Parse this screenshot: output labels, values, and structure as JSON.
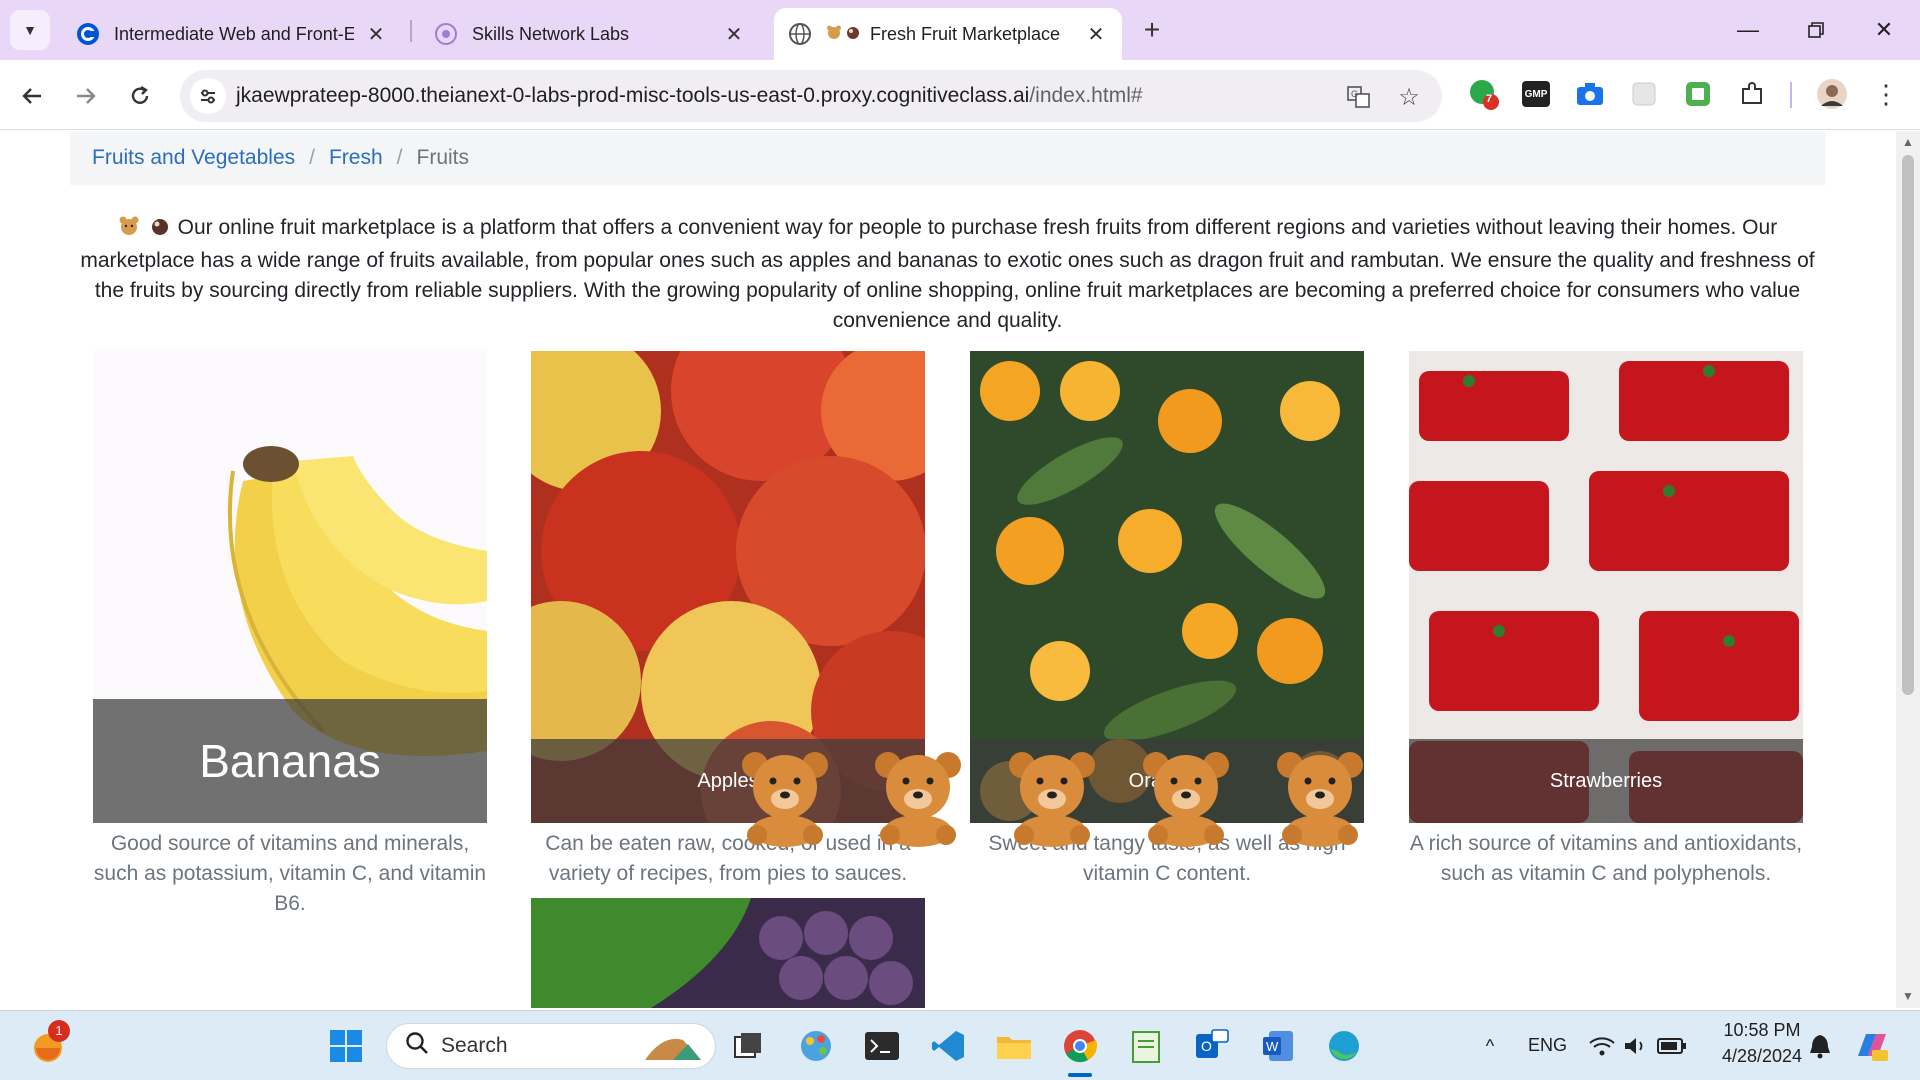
{
  "browser": {
    "tabs": [
      {
        "title": "Intermediate Web and Front-En",
        "close": "✕"
      },
      {
        "title": "Skills Network Labs",
        "close": "✕"
      },
      {
        "title": "Fresh Fruit Marketplace",
        "close": "✕",
        "active": true
      }
    ],
    "new_tab": "+",
    "url_host": "jkaewprateep-8000.theianext-0-labs-prod-misc-tools-us-east-0.proxy.cognitiveclass.ai",
    "url_path": "/index.html#",
    "extension_badge": "7",
    "gmp_label": "GMP"
  },
  "breadcrumb": {
    "items": [
      "Fruits and Vegetables",
      "Fresh"
    ],
    "current": "Fruits",
    "separator": "/"
  },
  "intro_text": "Our online fruit marketplace is a platform that offers a convenient way for people to purchase fresh fruits from different regions and varieties without leaving their homes. Our marketplace has a wide range of fruits available, from popular ones such as apples and bananas to exotic ones such as dragon fruit and rambutan. We ensure the quality and freshness of the fruits by sourcing directly from reliable suppliers. With the growing popularity of online shopping, online fruit marketplaces are becoming a preferred choice for consumers who value convenience and quality.",
  "fruits": [
    {
      "name": "Bananas",
      "desc": "Good source of vitamins and minerals, such as potassium, vitamin C, and vitamin B6."
    },
    {
      "name": "Apples",
      "desc": "Can be eaten raw, cooked, or used in a variety of recipes, from pies to sauces."
    },
    {
      "name": "Oranges",
      "desc": "Sweet and tangy taste, as well as high vitamin C content."
    },
    {
      "name": "Strawberries",
      "desc": "A rich source of vitamins and antioxidants, such as vitamin C and polyphenols."
    }
  ],
  "taskbar": {
    "search_placeholder": "Search",
    "notification_badge": "1",
    "lang": "ENG",
    "time": "10:58 PM",
    "date": "4/28/2024"
  }
}
